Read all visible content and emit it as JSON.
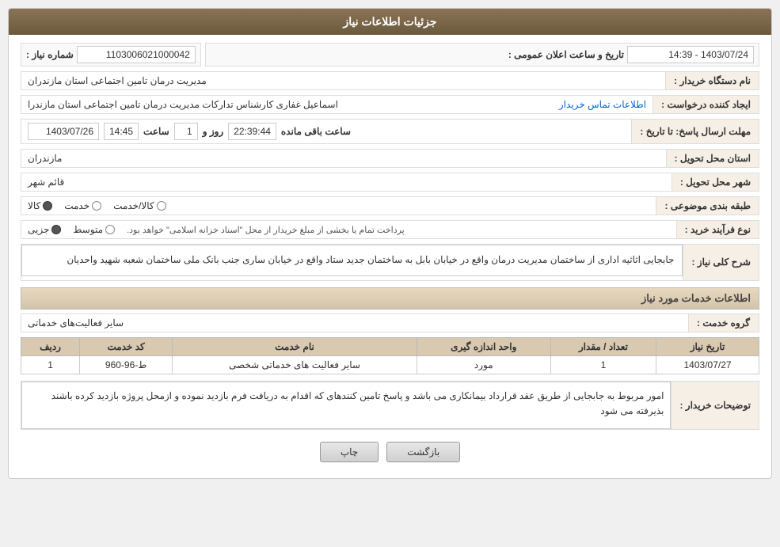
{
  "header": {
    "title": "جزئیات اطلاعات نیاز"
  },
  "fields": {
    "shomareNiaz_label": "شماره نیاز :",
    "shomareNiaz_value": "1103006021000042",
    "tarikhLabel": "تاریخ و ساعت اعلان عمومی :",
    "tarikh_value": "1403/07/24 - 14:39",
    "namDastgahLabel": "نام دستگاه خریدار :",
    "namDastgah_value": "مدیریت درمان تامین اجتماعی استان مازندران",
    "ijadKanandehLabel": "ایجاد کننده درخواست :",
    "ijadKanandeh_value": "اسماعیل غفاری کارشناس تدارکات مدیریت درمان تامین اجتماعی استان مازندرا",
    "etelaat_link": "اطلاعات تماس خریدار",
    "mohlatLabel": "مهلت ارسال پاسخ: تا تاریخ :",
    "mohlatDate_value": "1403/07/26",
    "mohlatTime_label": "ساعت",
    "mohlatTime_value": "14:45",
    "mohlatRoozLabel": "روز و",
    "mohlatRooz_value": "1",
    "mohlatSaat_value": "22:39:44",
    "mohlatSaatLabel": "ساعت باقی مانده",
    "ostanLabel": "استان محل تحویل :",
    "ostan_value": "مازندران",
    "shahrLabel": "شهر محل تحویل :",
    "shahr_value": "قائم شهر",
    "tabaqehLabel": "طبقه بندی موضوعی :",
    "radio1": "کالا",
    "radio2": "خدمت",
    "radio3": "کالا/خدمت",
    "noeFarayandLabel": "نوع فرآیند خرید :",
    "radio_jozvi": "جزیی",
    "radio_motavaset": "متوسط",
    "noeFarayand_note": "پرداخت تمام یا بخشی از مبلغ خریدار از محل \"اسناد خزانه اسلامی\" خواهد بود.",
    "sharhLabel": "شرح کلی نیاز :",
    "sharh_value": "جابجایی اثاثیه اداری از ساختمان مدیریت درمان واقع در خیابان بابل به ساختمان جدید ستاد واقع در خیابان ساری جنب بانک ملی ساختمان شعبه شهید واحدیان",
    "khadamatSection": "اطلاعات خدمات مورد نیاز",
    "gorohKhedmatLabel": "گروه خدمت :",
    "gorohKhedmat_value": "سایر فعالیت‌های خدماتی",
    "table": {
      "headers": [
        "ردیف",
        "کد خدمت",
        "نام خدمت",
        "واحد اندازه گیری",
        "تعداد / مقدار",
        "تاریخ نیاز"
      ],
      "rows": [
        {
          "radif": "1",
          "kodKhedmat": "ط-96-960",
          "namKhedmat": "سایر فعالیت های خدماتی شخصی",
          "vahed": "مورد",
          "tedad": "1",
          "tarikh": "1403/07/27"
        }
      ]
    },
    "tawzihatLabel": "توضیحات خریدار :",
    "tawzihat_value": "امور مربوط به جابجایی از طریق عقد قرارداد بیمانکاری می باشد و پاسخ تامین کنندهای که اقدام به دریافت فرم بازدید نموده و ازمحل پروژه بازدید کرده باشند بذیرفته می شود"
  },
  "buttons": {
    "print_label": "چاپ",
    "back_label": "بازگشت"
  }
}
